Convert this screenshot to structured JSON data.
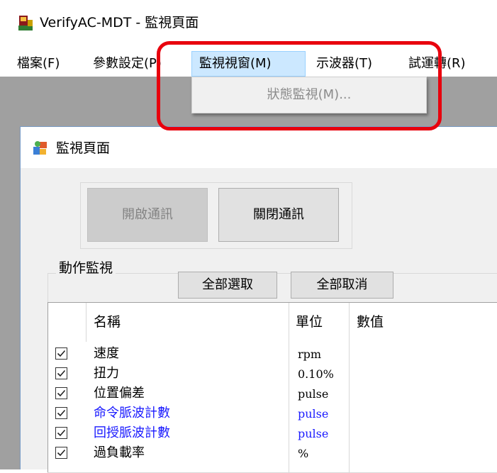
{
  "window": {
    "title": "VerifyAC-MDT - 監視頁面"
  },
  "menu": [
    {
      "label": "檔案(F)"
    },
    {
      "label": "參數設定(P)"
    },
    {
      "label": "監視視窗(M)"
    },
    {
      "label": "示波器(T)"
    },
    {
      "label": "試運轉(R)"
    }
  ],
  "dropdown": {
    "items": [
      {
        "label": "狀態監視(M)...",
        "enabled": false
      }
    ]
  },
  "child_window": {
    "title": "監視頁面",
    "open_comm_label": "開啟通訊",
    "close_comm_label": "關閉通訊",
    "monitor_group_label": "動作監視",
    "select_all_label": "全部選取",
    "deselect_all_label": "全部取消",
    "columns": [
      "名稱",
      "單位",
      "數值"
    ],
    "rows": [
      {
        "checked": true,
        "name": "速度",
        "unit": "rpm",
        "value": "",
        "highlight": false
      },
      {
        "checked": true,
        "name": "扭力",
        "unit": "0.10%",
        "value": "",
        "highlight": false
      },
      {
        "checked": true,
        "name": "位置偏差",
        "unit": "pulse",
        "value": "",
        "highlight": false
      },
      {
        "checked": true,
        "name": "命令脈波計數",
        "unit": "pulse",
        "value": "",
        "highlight": true
      },
      {
        "checked": true,
        "name": "回授脈波計數",
        "unit": "pulse",
        "value": "",
        "highlight": true
      },
      {
        "checked": true,
        "name": "過負載率",
        "unit": "%",
        "value": "",
        "highlight": false
      }
    ]
  },
  "colors": {
    "highlight_row_text": "#1a1aff",
    "annotation_box": "#e8000d",
    "menu_active_bg": "#cce8ff"
  },
  "icons": {
    "app": "servo-drive-icon",
    "child": "monitor-window-icon",
    "checkbox": "checkmark-icon"
  }
}
